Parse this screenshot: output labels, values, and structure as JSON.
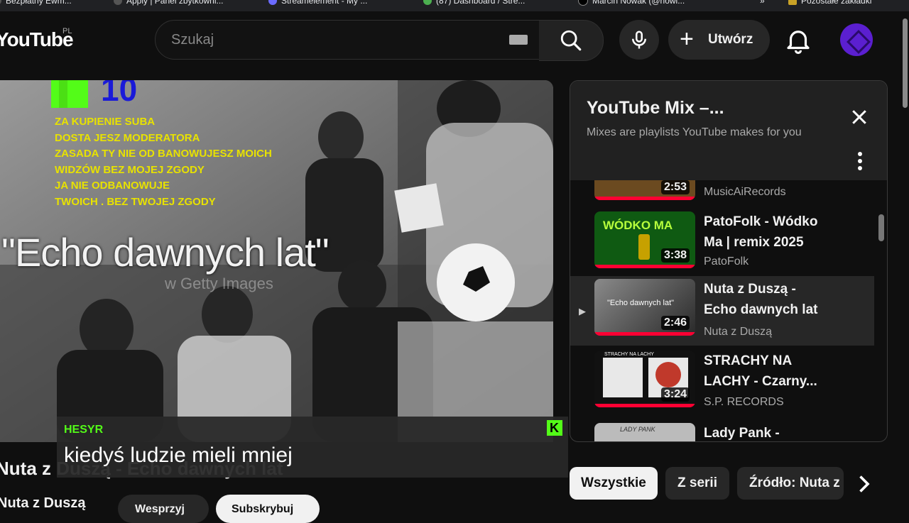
{
  "bookmarks": [
    "Bezpłatny Ewm...",
    "Apply | Panel zbytkowni...",
    "Streamelement - My ...",
    "(87) Dashboard / Stre...",
    "Marcin Nowak (@nowi...",
    "Pozostałe zakładki"
  ],
  "header": {
    "logo": "YouTube",
    "country": "PL",
    "search_placeholder": "Szukaj",
    "create_label": "Utwórz"
  },
  "player": {
    "overlay_title": "\"Echo dawnych lat\"",
    "watermark": "w Getty Images",
    "kick_count": "10",
    "rules": [
      "ZA KUPIENIE SUBA",
      "DOSTA JESZ MODERATORA",
      "ZASADA  TY NIE OD BANOWUJESZ MOICH",
      "WIDZÓW BEZ MOJEJ ZGODY",
      "JA NIE ODBANOWUJE",
      "TWOICH . BEZ TWOJEJ ZGODY"
    ],
    "chat_user": "HESYR",
    "chat_message": "kiedyś ludzie mieli mniej"
  },
  "video": {
    "title": "Nuta z Duszą - Echo dawnych lat",
    "channel": "Nuta z Duszą",
    "support_label": "Wesprzyj",
    "subscribe_label": "Subskrybuj"
  },
  "mix": {
    "title": "YouTube Mix –...",
    "subtitle": "Mixes are playlists YouTube makes for you",
    "items": [
      {
        "title": "",
        "channel": "MusicAiRecords",
        "duration": "2:53",
        "color": "#6b4a20"
      },
      {
        "title": "PatoFolk - Wódko Ma | remix 2025",
        "channel": "PatoFolk",
        "duration": "3:38",
        "thumb_text": "WÓDKO MA",
        "color": "#0f5a12"
      },
      {
        "title": "Nuta z Duszą - Echo dawnych lat",
        "channel": "Nuta z Duszą",
        "duration": "2:46",
        "thumb_text": "\"Echo dawnych lat\"",
        "color": "#4a4a4a"
      },
      {
        "title": "STRACHY NA LACHY - Czarny...",
        "channel": "S.P. RECORDS",
        "duration": "3:24",
        "thumb_text": "STRACHY NA LACHY",
        "color": "#d9d9d9"
      },
      {
        "title": "Lady Pank -",
        "channel": "",
        "duration": "",
        "thumb_text": "LADY PANK",
        "color": "#bbbbbb"
      }
    ]
  },
  "chips": [
    "Wszystkie",
    "Z serii",
    "Źródło: Nuta z"
  ]
}
